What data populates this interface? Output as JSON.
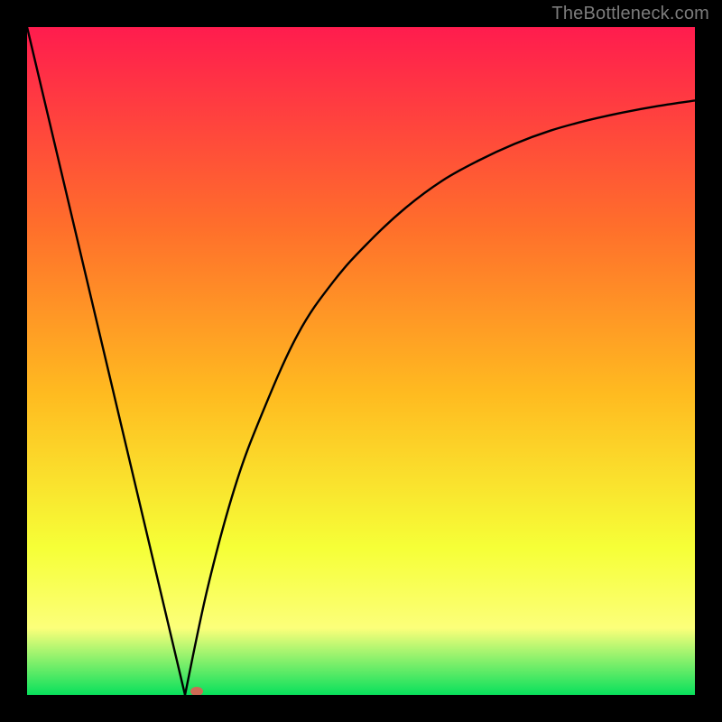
{
  "watermark": "TheBottleneck.com",
  "colors": {
    "gradient_top": "#ff1c4e",
    "gradient_upper_mid": "#ff6f2b",
    "gradient_mid": "#ffbb20",
    "gradient_lower_mid": "#f6ff37",
    "gradient_yellow_band": "#fcff7a",
    "gradient_bottom": "#08e05c",
    "curve": "#000000",
    "marker_fill": "#cf6a55",
    "frame_bg": "#000000"
  },
  "chart_data": {
    "type": "line",
    "title": "",
    "xlabel": "",
    "ylabel": "",
    "x_range": [
      0,
      740
    ],
    "y_range_percent": [
      0,
      100
    ],
    "left_segment": {
      "x": [
        0,
        175
      ],
      "y_percent": [
        100,
        0
      ]
    },
    "right_curve": {
      "x": [
        175,
        200,
        230,
        260,
        300,
        340,
        380,
        420,
        460,
        500,
        540,
        580,
        620,
        660,
        700,
        740
      ],
      "y_percent": [
        0,
        16,
        31,
        42,
        54,
        62,
        68,
        73,
        77,
        80,
        82.5,
        84.5,
        86,
        87.2,
        88.2,
        89
      ]
    },
    "marker": {
      "x": 188,
      "y_percent": 0
    },
    "annotations": [],
    "legend": []
  }
}
